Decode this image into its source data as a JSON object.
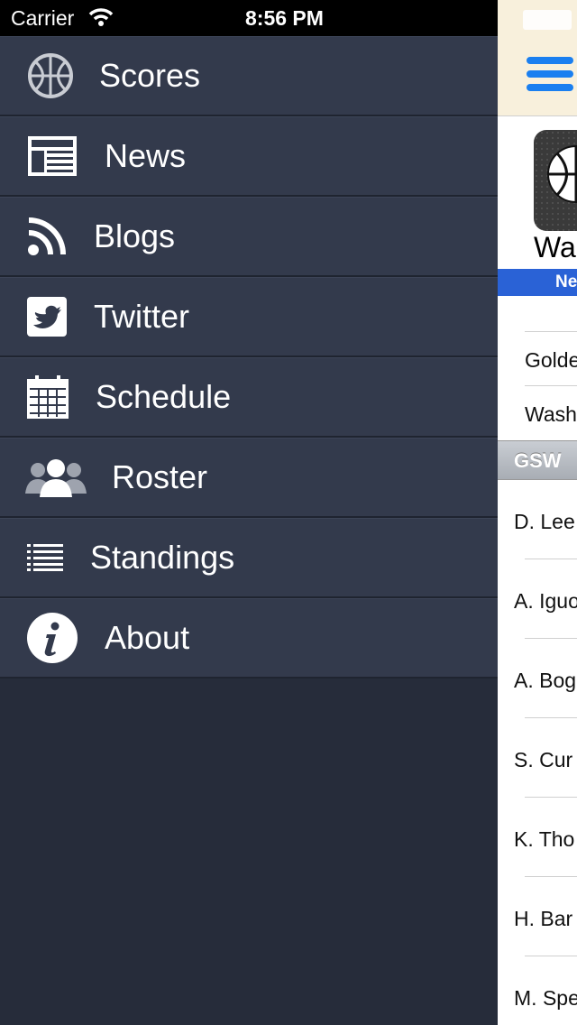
{
  "status_bar": {
    "carrier": "Carrier",
    "time": "8:56 PM"
  },
  "menu": {
    "items": [
      {
        "label": "Scores",
        "icon": "basketball-icon"
      },
      {
        "label": "News",
        "icon": "newspaper-icon"
      },
      {
        "label": "Blogs",
        "icon": "rss-icon"
      },
      {
        "label": "Twitter",
        "icon": "twitter-icon"
      },
      {
        "label": "Schedule",
        "icon": "calendar-icon"
      },
      {
        "label": "Roster",
        "icon": "people-icon"
      },
      {
        "label": "Standings",
        "icon": "list-icon"
      },
      {
        "label": "About",
        "icon": "info-icon"
      }
    ]
  },
  "content": {
    "team_name": "Wa",
    "blue_bar_text": "Ne",
    "scores": [
      "Golde",
      "Wash"
    ],
    "section_header": "GSW",
    "players": [
      "D. Lee",
      "A. Iguo",
      "A. Bog",
      "S. Cur",
      "K. Tho",
      "H. Bar",
      "M. Spe"
    ]
  },
  "colors": {
    "menu_bg": "#333a4c",
    "accent_blue": "#1a7ff0",
    "bar_blue": "#2a62d6"
  }
}
